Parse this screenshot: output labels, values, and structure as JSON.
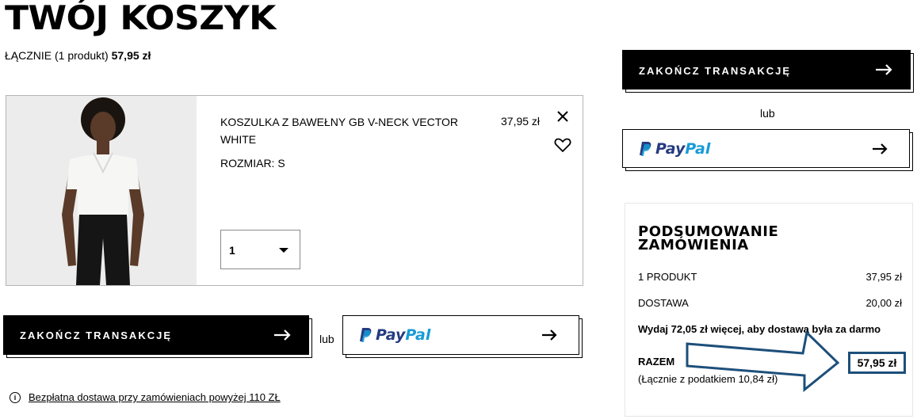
{
  "header": {
    "title": "TWÓJ KOSZYK",
    "total_prefix": "ŁĄCZNIE (1 produkt)",
    "total_amount": "57,95 zł"
  },
  "cart_item": {
    "name": "KOSZULKA Z BAWEŁNY GB V-NECK VECTOR WHITE",
    "size": "ROZMIAR: S",
    "price": "37,95 zł",
    "quantity": "1",
    "remove_icon": "close-icon",
    "wishlist_icon": "heart-icon"
  },
  "actions": {
    "checkout_label": "ZAKOŃCZ TRANSAKCJĘ",
    "or_label": "lub",
    "paypal_pay": "Pay",
    "paypal_pal": "Pal"
  },
  "free_shipping": {
    "icon": "info-icon",
    "text": "Bezpłatna dostawa przy zamówieniach powyżej 110 ZŁ"
  },
  "summary": {
    "title": "PODSUMOWANIE ZAMÓWIENIA",
    "rows": [
      {
        "label": "1 PRODUKT",
        "value": "37,95 zł"
      },
      {
        "label": "DOSTAWA",
        "value": "20,00 zł"
      }
    ],
    "promo": "Wydaj 72,05 zł więcej, aby dostawa była za darmo",
    "total_label": "RAZEM",
    "tax_note": "(Łącznie z podatkiem  10,84 zł)",
    "total_value": "57,95 zł"
  },
  "colors": {
    "annotation": "#1d4f7a",
    "paypal_dark": "#253b80",
    "paypal_light": "#179bd7"
  }
}
